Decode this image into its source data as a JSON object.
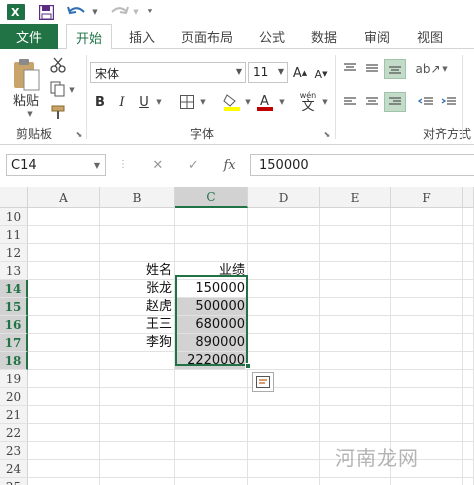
{
  "colors": {
    "brand": "#217346",
    "excel_green": "#1e7145",
    "selection": "#217346",
    "font_red": "#c00000",
    "fill_yellow": "#ffff00"
  },
  "qat": {
    "icons": [
      "excel-logo-icon",
      "save-icon",
      "undo-icon",
      "redo-icon",
      "customize-icon"
    ]
  },
  "tabs": {
    "file": "文件",
    "items": [
      "开始",
      "插入",
      "页面布局",
      "公式",
      "数据",
      "审阅",
      "视图"
    ],
    "active": "开始"
  },
  "ribbon": {
    "clipboard": {
      "paste_label": "粘贴",
      "group_label": "剪贴板"
    },
    "font": {
      "font_name": "宋体",
      "font_size": "11",
      "group_label": "字体",
      "wen_label": "wén",
      "wen_char": "文",
      "bold": "B",
      "italic": "I",
      "underline": "U"
    },
    "align": {
      "group_label": "对齐方式"
    }
  },
  "formula_bar": {
    "name_box": "C14",
    "fx": "fx",
    "value": "150000"
  },
  "sheet": {
    "columns": [
      "A",
      "B",
      "C",
      "D",
      "E",
      "F"
    ],
    "selected_column": "C",
    "rows": [
      {
        "num": "10",
        "b": "",
        "c": "",
        "sel": false
      },
      {
        "num": "11",
        "b": "",
        "c": "",
        "sel": false
      },
      {
        "num": "12",
        "b": "",
        "c": "",
        "sel": false
      },
      {
        "num": "13",
        "b": "姓名",
        "c": "业绩",
        "sel": false
      },
      {
        "num": "14",
        "b": "张龙",
        "c": "150000",
        "sel": true
      },
      {
        "num": "15",
        "b": "赵虎",
        "c": "500000",
        "sel": true
      },
      {
        "num": "16",
        "b": "王三",
        "c": "680000",
        "sel": true
      },
      {
        "num": "17",
        "b": "李狗",
        "c": "890000",
        "sel": true
      },
      {
        "num": "18",
        "b": "",
        "c": "2220000",
        "sel": true
      },
      {
        "num": "19",
        "b": "",
        "c": "",
        "sel": false
      },
      {
        "num": "20",
        "b": "",
        "c": "",
        "sel": false
      },
      {
        "num": "21",
        "b": "",
        "c": "",
        "sel": false
      },
      {
        "num": "22",
        "b": "",
        "c": "",
        "sel": false
      },
      {
        "num": "23",
        "b": "",
        "c": "",
        "sel": false
      },
      {
        "num": "24",
        "b": "",
        "c": "",
        "sel": false
      },
      {
        "num": "25",
        "b": "",
        "c": "",
        "sel": false
      }
    ]
  },
  "watermark": "河南龙网"
}
